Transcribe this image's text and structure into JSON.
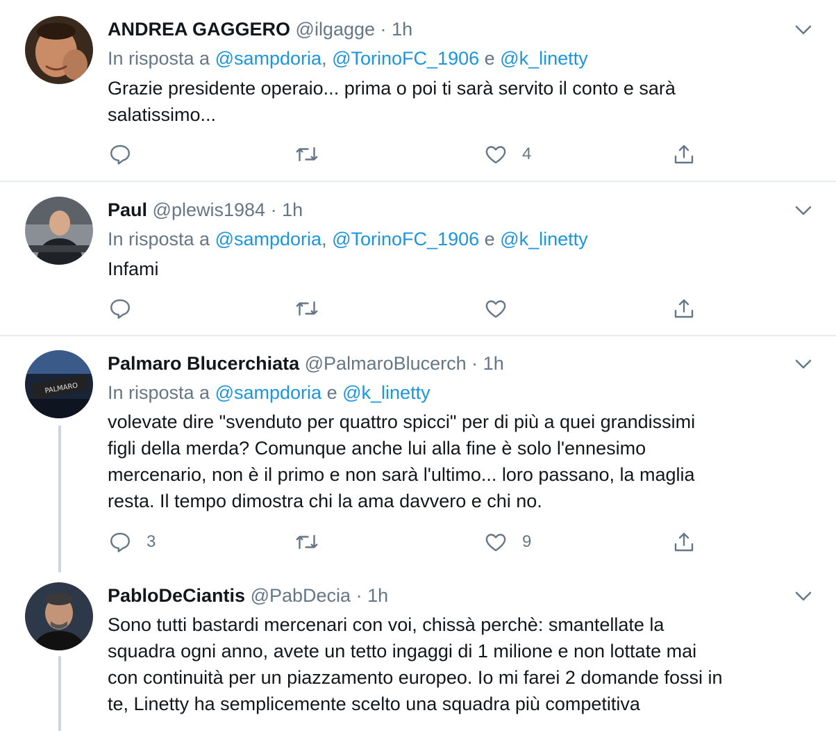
{
  "tweets": [
    {
      "name": "ANDREA GAGGERO",
      "handle": "@ilgagge",
      "sep": "·",
      "time": "1h",
      "reply_prefix": "In risposta a",
      "mentions": [
        "@sampdoria",
        "@TorinoFC_1906",
        "@k_linetty"
      ],
      "joiners": [
        ", ",
        " e "
      ],
      "text_lines": [
        "Grazie presidente operaio... prima o poi ti sarà servito il conto e sarà",
        "salatissimo..."
      ],
      "reply_count": "",
      "retweet_count": "",
      "like_count": "4"
    },
    {
      "name": "Paul",
      "handle": "@plewis1984",
      "sep": "·",
      "time": "1h",
      "reply_prefix": "In risposta a",
      "mentions": [
        "@sampdoria",
        "@TorinoFC_1906",
        "@k_linetty"
      ],
      "joiners": [
        ", ",
        " e "
      ],
      "text_lines": [
        "Infami"
      ],
      "reply_count": "",
      "retweet_count": "",
      "like_count": ""
    },
    {
      "name": "Palmaro Blucerchiata",
      "handle": "@PalmaroBlucerch",
      "sep": "·",
      "time": "1h",
      "reply_prefix": "In risposta a",
      "mentions": [
        "@sampdoria",
        "@k_linetty"
      ],
      "joiners": [
        " e "
      ],
      "text_lines": [
        "volevate dire \"svenduto per quattro spicci\" per di più a quei grandissimi",
        "figli della merda? Comunque anche lui alla fine è solo l'ennesimo",
        "mercenario, non è il primo e non sarà l'ultimo... loro passano, la maglia",
        "resta. Il tempo dimostra chi la ama davvero e chi no."
      ],
      "reply_count": "3",
      "retweet_count": "",
      "like_count": "9"
    },
    {
      "name": "PabloDeCiantis",
      "handle": "@PabDecia",
      "sep": "·",
      "time": "1h",
      "text_lines": [
        "Sono tutti bastardi mercenari con voi, chissà perchè: smantellate la",
        "squadra ogni anno, avete un tetto ingaggi di 1 milione e non lottate mai",
        "con continuità per un piazzamento europeo. Io mi farei 2 domande fossi in",
        "te, Linetty ha semplicemente scelto una squadra più competitiva"
      ]
    }
  ],
  "colors": {
    "link": "#1b95e0",
    "secondary": "#657786",
    "separator": "#e6ecf0",
    "thread": "#ccd6dd"
  },
  "icons": [
    "reply-icon",
    "retweet-icon",
    "like-icon",
    "share-icon",
    "chevron-down-icon"
  ]
}
